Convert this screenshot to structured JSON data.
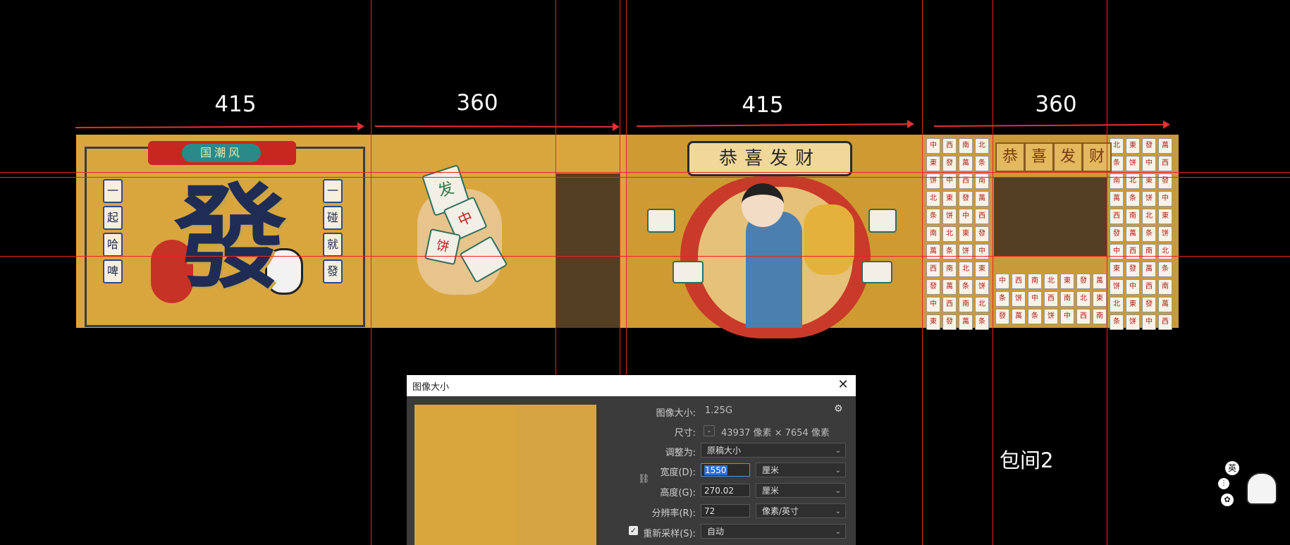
{
  "canvas": {
    "dimensions": [
      "415",
      "360",
      "415",
      "360"
    ],
    "room_label": "包间2"
  },
  "panel1": {
    "banner_text": "国潮风",
    "left_tiles": [
      "一",
      "起",
      "哈",
      "啤"
    ],
    "right_tiles": [
      "一",
      "碰",
      "就",
      "發"
    ],
    "big_char": "發"
  },
  "panel2": {
    "tiles": [
      "发",
      "中",
      "饼"
    ]
  },
  "panel3": {
    "title": "恭喜发财"
  },
  "panel4": {
    "title_chars": [
      "恭",
      "喜",
      "发",
      "财"
    ],
    "tile_glyphs": [
      "中",
      "西",
      "南",
      "北",
      "東",
      "發",
      "萬",
      "条",
      "饼"
    ]
  },
  "dialog": {
    "title": "图像大小",
    "close_glyph": "✕",
    "image_size_label": "图像大小:",
    "image_size_value": "1.25G",
    "gear_glyph": "⚙",
    "dimensions_label": "尺寸:",
    "dimensions_value": "43937 像素  ×  7654 像素",
    "fit_label": "调整为:",
    "fit_value": "原稿大小",
    "width_label": "宽度(D):",
    "width_value": "1550",
    "width_unit": "厘米",
    "height_label": "高度(G):",
    "height_value": "270.02",
    "height_unit": "厘米",
    "resolution_label": "分辨率(R):",
    "resolution_value": "72",
    "resolution_unit": "像素/英寸",
    "resample_label": "重新采样(S):",
    "resample_value": "自动",
    "resample_checked": "✓"
  },
  "ime": {
    "mode": "英"
  },
  "colors": {
    "guide": "#e22222",
    "panel_gold": "#d9a63e",
    "dialog_bg": "#3b3b3b"
  }
}
